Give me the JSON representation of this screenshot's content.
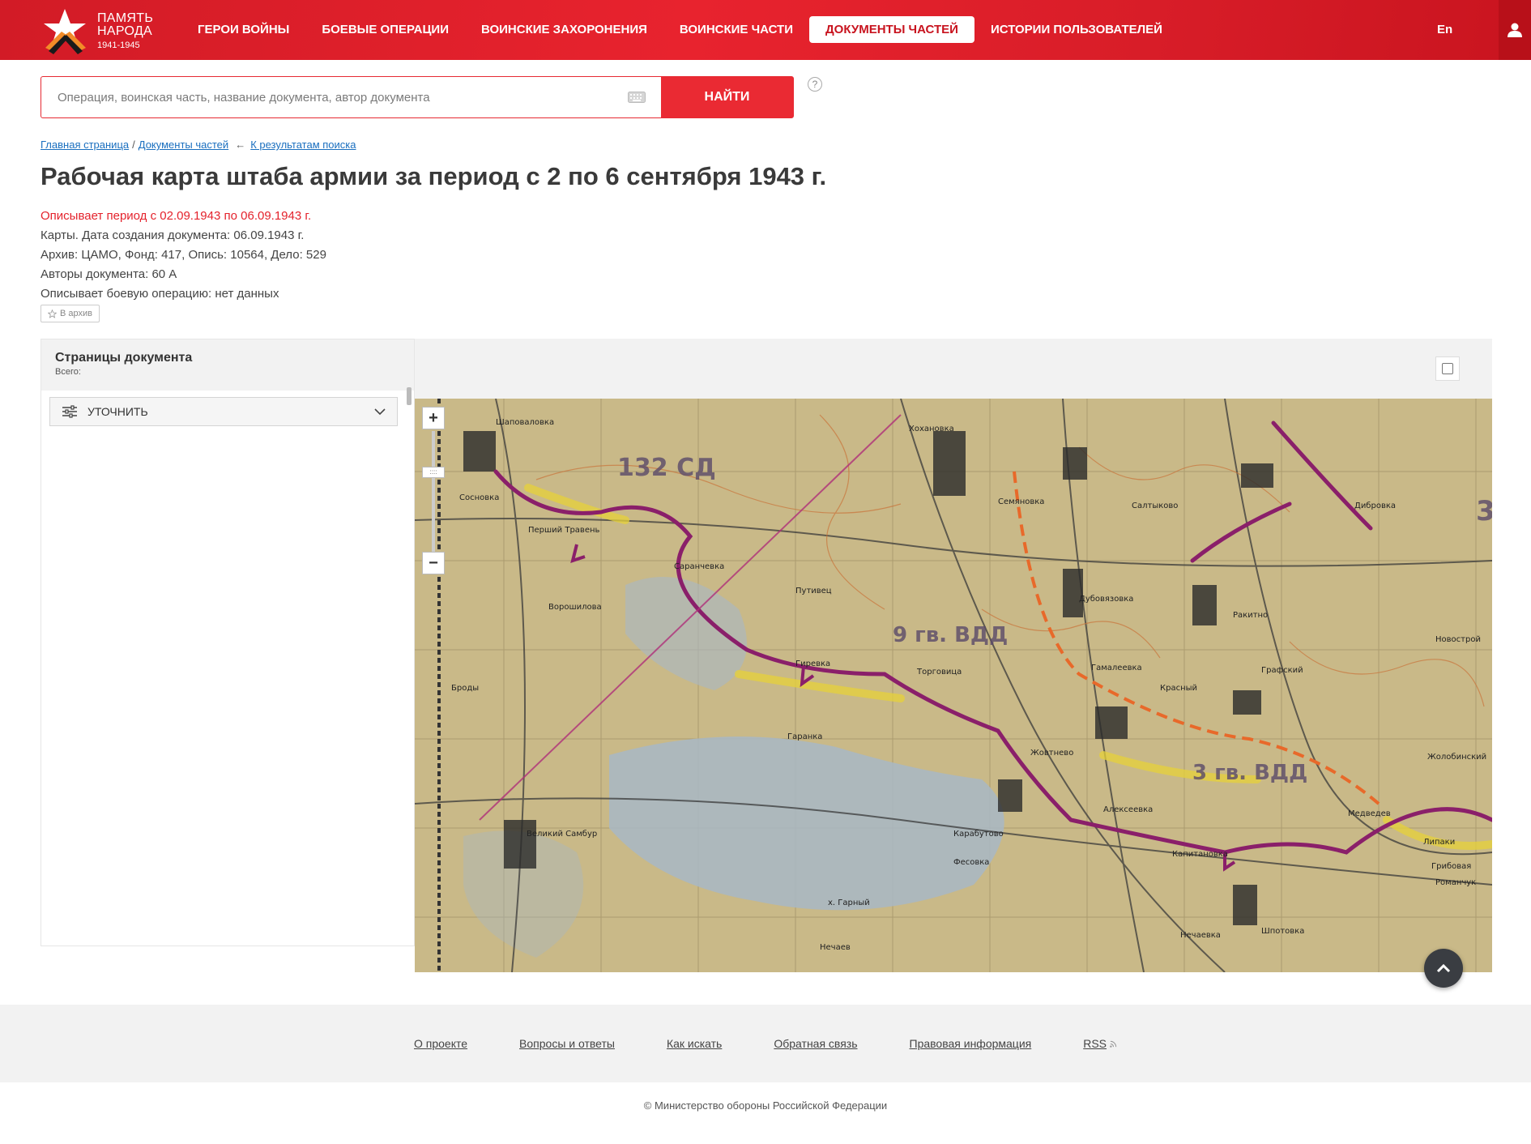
{
  "header": {
    "logo": {
      "line1": "ПАМЯТЬ",
      "line2": "НАРОДА",
      "years": "1941-1945"
    },
    "nav": [
      {
        "label": "ГЕРОИ ВОЙНЫ",
        "active": false
      },
      {
        "label": "БОЕВЫЕ ОПЕРАЦИИ",
        "active": false
      },
      {
        "label": "ВОИНСКИЕ ЗАХОРОНЕНИЯ",
        "active": false
      },
      {
        "label": "ВОИНСКИЕ ЧАСТИ",
        "active": false
      },
      {
        "label": "ДОКУМЕНТЫ ЧАСТЕЙ",
        "active": true
      },
      {
        "label": "ИСТОРИИ ПОЛЬЗОВАТЕЛЕЙ",
        "active": false
      }
    ],
    "lang": "En",
    "user_icon": "user-icon",
    "accent_color": "#e4222c"
  },
  "search": {
    "placeholder": "Операция, воинская часть, название документа, автор документа",
    "value": "",
    "button_label": "НАЙТИ",
    "help_label": "?"
  },
  "breadcrumb": {
    "home": "Главная страница",
    "separator": "/",
    "section": "Документы частей",
    "back_arrow": "←",
    "back_link": "К результатам поиска"
  },
  "document": {
    "title": "Рабочая карта штаба армии за период с 2 по 6 сентября 1943 г.",
    "period": "Описывает период с 02.09.1943 по 06.09.1943 г.",
    "type_date": "Карты. Дата создания документа: 06.09.1943 г.",
    "archive": "Архив: ЦАМО, Фонд: 417, Опись: 10564, Дело: 529",
    "authors": "Авторы документа: 60 А",
    "operation": "Описывает боевую операцию: нет данных",
    "archive_button": "В архив"
  },
  "viewer": {
    "sidebar_title": "Страницы документа",
    "sidebar_total": "Всего:",
    "refine_label": "УТОЧНИТЬ",
    "zoom_in": "+",
    "zoom_out": "−",
    "zoom_handle": "::::",
    "map_labels": {
      "division_1": "132 СД",
      "division_2": "9 гв. ВДД",
      "division_3": "3 гв. ВДД",
      "division_4": "3",
      "villages": [
        "Шаповаловка",
        "Сосновка",
        "Перший Травень",
        "Саранчевка",
        "Путивец",
        "Семяновка",
        "Салтыково",
        "Дубовязовка",
        "Ракитно",
        "Новострой",
        "Гиревка",
        "Торговица",
        "Гамалеевка",
        "Красный",
        "Графский",
        "Жовтнево",
        "Великий Самбур",
        "Карабутово",
        "Фесовка",
        "Шпотовка",
        "Медведев",
        "Нечаев",
        "Романчук",
        "Броды",
        "Ворошилова",
        "Хохановка",
        "Дибровка",
        "Жолобинский",
        "Гаранка",
        "Липаки",
        "х. Гарный",
        "Алексеевка",
        "Нечаевка",
        "Капитановка",
        "Грибовая"
      ]
    }
  },
  "footer": {
    "links": [
      "О проекте",
      "Вопросы и ответы",
      "Как искать",
      "Обратная связь",
      "Правовая информация",
      "RSS"
    ],
    "copyright": "© Министерство обороны Российской Федерации"
  }
}
